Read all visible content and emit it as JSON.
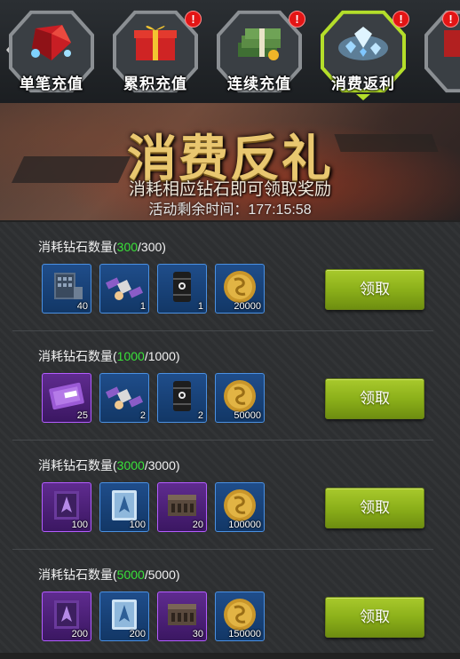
{
  "tabs": [
    {
      "label": "单笔充值",
      "badge": "",
      "active": false
    },
    {
      "label": "累积充值",
      "badge": "!",
      "active": false
    },
    {
      "label": "连续充值",
      "badge": "!",
      "active": false
    },
    {
      "label": "消费返利",
      "badge": "!",
      "active": true
    },
    {
      "label": "",
      "badge": "!",
      "active": false
    }
  ],
  "banner": {
    "title": "消费反礼",
    "subtitle": "消耗相应钻石即可领取奖励",
    "timer_label": "活动剩余时间：",
    "timer_value": "177:15:58"
  },
  "rows": [
    {
      "req_prefix": "消耗钻石数量(",
      "current": "300",
      "total": "/300)",
      "claim_label": "领取",
      "items": [
        {
          "icon": "supply-crate-icon",
          "count": "40",
          "rarity": "blue"
        },
        {
          "icon": "satellite-icon",
          "count": "1",
          "rarity": "blue"
        },
        {
          "icon": "oil-barrel-icon",
          "count": "1",
          "rarity": "blue"
        },
        {
          "icon": "gold-coin-icon",
          "count": "20000",
          "rarity": "blue"
        }
      ]
    },
    {
      "req_prefix": "消耗钻石数量(",
      "current": "1000",
      "total": "/1000)",
      "claim_label": "领取",
      "items": [
        {
          "icon": "ticket-icon",
          "count": "25",
          "rarity": "purple"
        },
        {
          "icon": "satellite-icon",
          "count": "2",
          "rarity": "blue"
        },
        {
          "icon": "oil-barrel-icon",
          "count": "2",
          "rarity": "blue"
        },
        {
          "icon": "gold-coin-icon",
          "count": "50000",
          "rarity": "blue"
        }
      ]
    },
    {
      "req_prefix": "消耗钻石数量(",
      "current": "3000",
      "total": "/3000)",
      "claim_label": "领取",
      "items": [
        {
          "icon": "fighter-chip-icon",
          "count": "100",
          "rarity": "purple"
        },
        {
          "icon": "fighter-card-icon",
          "count": "100",
          "rarity": "blue"
        },
        {
          "icon": "ammo-crate-icon",
          "count": "20",
          "rarity": "purple"
        },
        {
          "icon": "gold-coin-icon",
          "count": "100000",
          "rarity": "blue"
        }
      ]
    },
    {
      "req_prefix": "消耗钻石数量(",
      "current": "5000",
      "total": "/5000)",
      "claim_label": "领取",
      "items": [
        {
          "icon": "fighter-chip-icon",
          "count": "200",
          "rarity": "purple"
        },
        {
          "icon": "fighter-card-icon",
          "count": "200",
          "rarity": "blue"
        },
        {
          "icon": "ammo-crate-icon",
          "count": "30",
          "rarity": "purple"
        },
        {
          "icon": "gold-coin-icon",
          "count": "150000",
          "rarity": "blue"
        }
      ]
    }
  ],
  "colors": {
    "accent_green": "#b4de2a",
    "current_value_green": "#39e239",
    "badge_red": "#e31515",
    "banner_gold": "#e9c770"
  }
}
